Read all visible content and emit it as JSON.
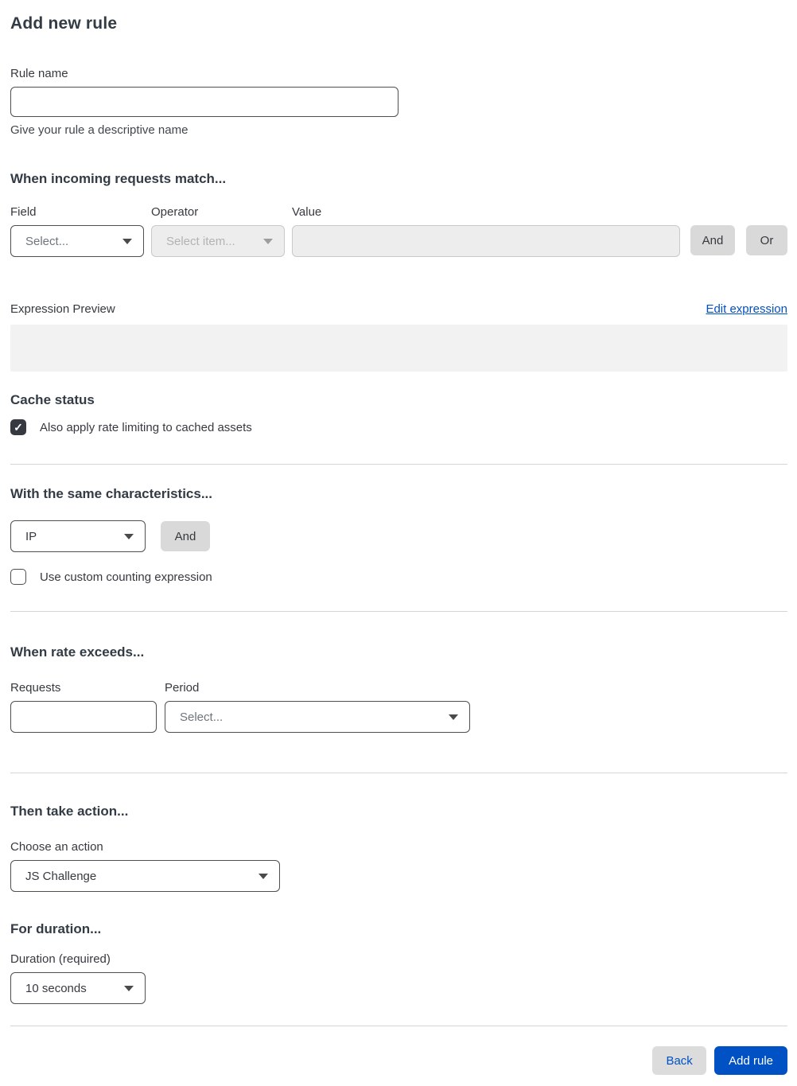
{
  "title": "Add new rule",
  "icons": {
    "check": "✓"
  },
  "colors": {
    "accent_blue": "#0051c3",
    "button_gray": "#d9d9d9",
    "preview_gray": "#f2f2f2",
    "checkbox_dark": "#36393f",
    "disabled_bg": "#ededed"
  },
  "rule_name": {
    "label": "Rule name",
    "value": "",
    "helper": "Give your rule a descriptive name"
  },
  "match": {
    "heading": "When incoming requests match...",
    "field_label": "Field",
    "field_value": "Select...",
    "operator_label": "Operator",
    "operator_value": "Select item...",
    "value_label": "Value",
    "value_text": "",
    "and_label": "And",
    "or_label": "Or"
  },
  "expression": {
    "label": "Expression Preview",
    "edit_link": "Edit expression",
    "preview_text": ""
  },
  "cache": {
    "heading": "Cache status",
    "checkbox_label": "Also apply rate limiting to cached assets",
    "checked": true
  },
  "characteristics": {
    "heading": "With the same characteristics...",
    "select_value": "IP",
    "and_label": "And",
    "checkbox_label": "Use custom counting expression",
    "checked": false
  },
  "rate": {
    "heading": "When rate exceeds...",
    "requests_label": "Requests",
    "requests_value": "",
    "period_label": "Period",
    "period_value": "Select..."
  },
  "action": {
    "heading": "Then take action...",
    "label": "Choose an action",
    "value": "JS Challenge"
  },
  "duration": {
    "heading": "For duration...",
    "label": "Duration (required)",
    "value": "10 seconds"
  },
  "footer": {
    "back_label": "Back",
    "add_rule_label": "Add rule"
  }
}
